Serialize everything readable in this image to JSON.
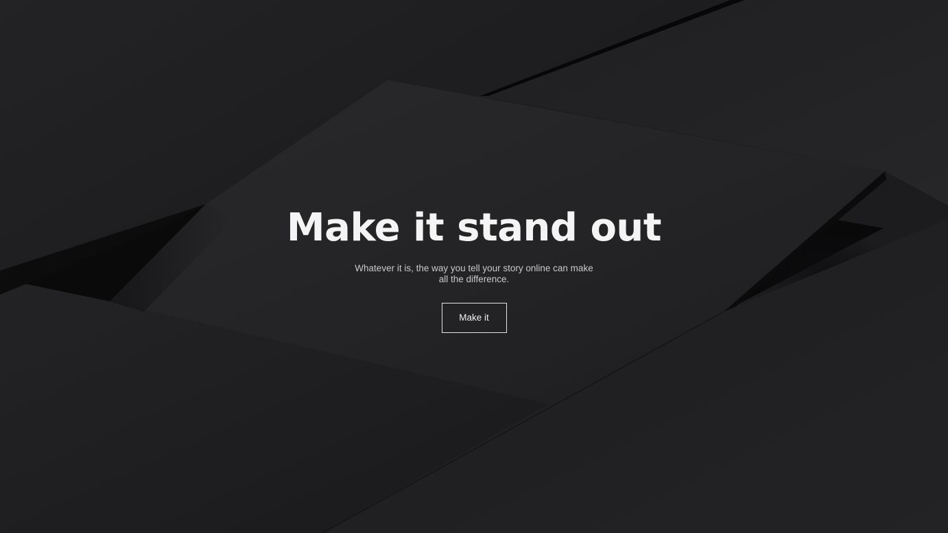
{
  "hero": {
    "title": "Make it stand out",
    "subtitle": "Whatever it is, the way you tell your story online can make all the difference.",
    "cta_label": "Make it"
  },
  "colors": {
    "background": "#1d1d1f",
    "title_text": "#f4f4f4",
    "subtitle_text": "#c9c9cb",
    "button_border": "#e6e6e6"
  }
}
